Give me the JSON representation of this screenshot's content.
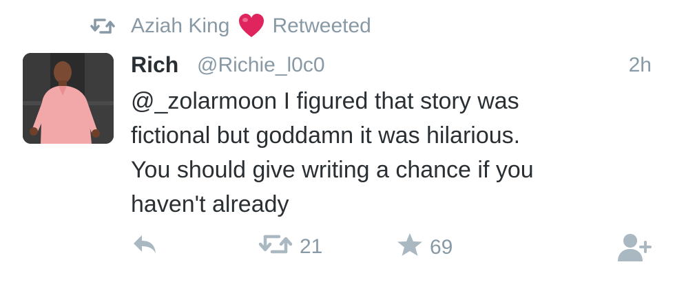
{
  "retweet_context": {
    "icon": "retweet-icon",
    "user": "Aziah King",
    "heart": "heart-emoji",
    "label": "Retweeted"
  },
  "tweet": {
    "author_name": "Rich",
    "author_handle": "@Richie_l0c0",
    "time": "2h",
    "text_lines": [
      "@_zolarmoon I figured that story was",
      "fictional but goddamn it was hilarious.",
      "You should give writing a chance if you",
      "haven't already"
    ]
  },
  "actions": {
    "reply_icon": "reply-icon",
    "retweet_icon": "retweet-icon",
    "retweet_count": "21",
    "like_icon": "star-icon",
    "like_count": "69",
    "follow_icon": "follow-user-icon"
  },
  "colors": {
    "text": "#292f33",
    "muted": "#8899a6",
    "icon": "#aab8c2",
    "heart": "#e0245e"
  }
}
